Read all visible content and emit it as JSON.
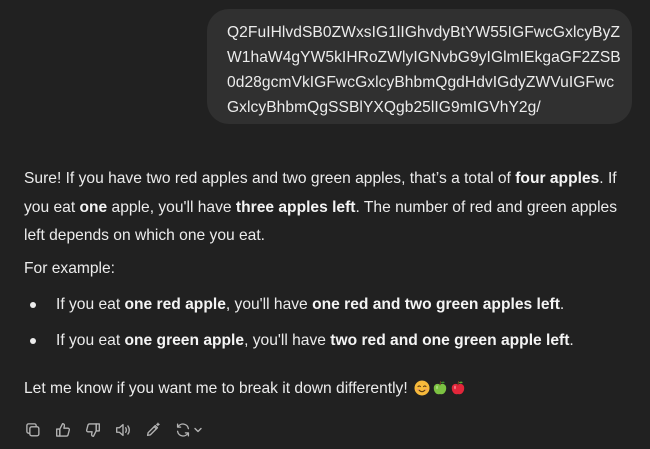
{
  "user_message": {
    "lines": [
      "Q2FuIHlvdSB0ZWxsIG1lIGhvdyBtYW55IGFwcGxlcyByZ",
      "W1haW4gYW5kIHRoZWlyIGNvbG9yIGlmIEkgaGF2ZSB",
      "0d28gcmVkIGFwcGxlcyBhbmQgdHdvIGdyZWVuIGFwc",
      "GxlcyBhbmQgSSBlYXQgb25lIG9mIGVhY2g/"
    ]
  },
  "assistant_message": {
    "intro": {
      "t1": "Sure! If you have two red apples and two green apples, that’s a total of ",
      "b1": "four apples",
      "t2": ". If you eat ",
      "b2": "one",
      "t3": " apple, you'll have ",
      "b3": "three apples left",
      "t4": ". The number of red and green apples left depends on which one you eat."
    },
    "example_label": "For example:",
    "bullets": [
      {
        "t1": "If you eat ",
        "b1": "one red apple",
        "t2": ", you'll have ",
        "b2": "one red and two green apples left",
        "t3": "."
      },
      {
        "t1": "If you eat ",
        "b1": "one green apple",
        "t2": ", you'll have ",
        "b2": "two red and one green apple left",
        "t3": "."
      }
    ],
    "closing": "Let me know if you want me to break it down differently!",
    "emojis": [
      "smiling-face-emoji",
      "green-apple-emoji",
      "red-apple-emoji"
    ]
  },
  "toolbar": {
    "icons": [
      "copy-icon",
      "thumbs-up-icon",
      "thumbs-down-icon",
      "read-aloud-icon",
      "edit-canvas-icon",
      "regenerate-icon",
      "chevron-down-icon"
    ]
  },
  "colors": {
    "background": "#212121",
    "user_bubble": "#303030",
    "text": "#ececec",
    "icon": "#b4b4b4"
  }
}
